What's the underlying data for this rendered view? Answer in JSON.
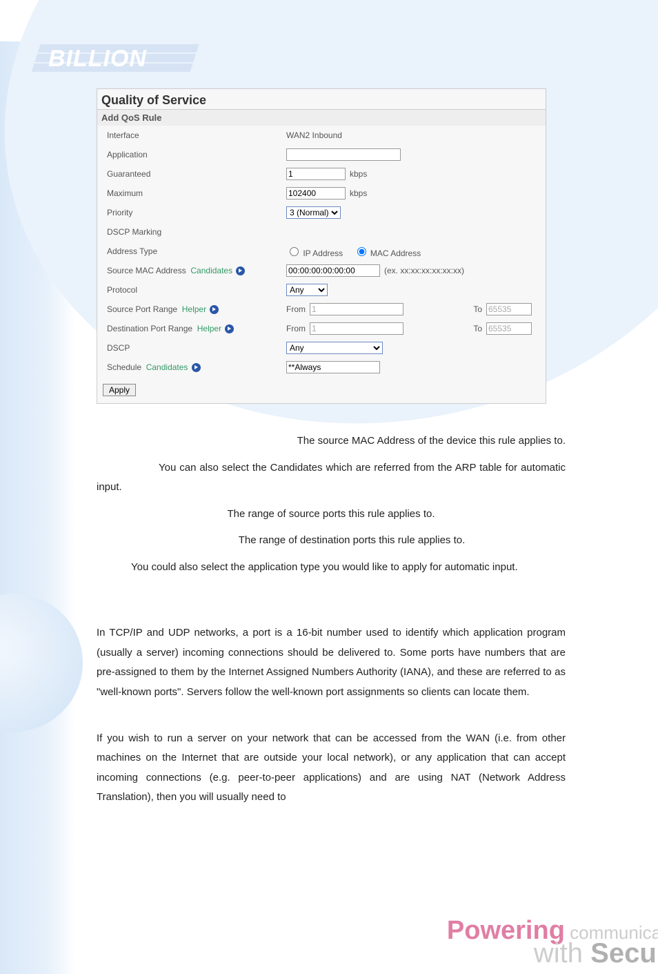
{
  "logo_text": "BILLION",
  "panel": {
    "title": "Quality of Service",
    "subtitle": "Add QoS Rule",
    "rows": {
      "interface": {
        "label": "Interface",
        "value": "WAN2 Inbound"
      },
      "application": {
        "label": "Application",
        "value": ""
      },
      "guaranteed": {
        "label": "Guaranteed",
        "value": "1",
        "unit": "kbps"
      },
      "maximum": {
        "label": "Maximum",
        "value": "102400",
        "unit": "kbps"
      },
      "priority": {
        "label": "Priority",
        "value": "3 (Normal)"
      },
      "dscp_marking": {
        "label": "DSCP Marking"
      },
      "address_type": {
        "label": "Address Type",
        "opt_ip": "IP Address",
        "opt_mac": "MAC Address",
        "selected": "mac"
      },
      "source_mac": {
        "label": "Source MAC Address",
        "link": "Candidates",
        "value": "00:00:00:00:00:00",
        "hint": "(ex. xx:xx:xx:xx:xx:xx)"
      },
      "protocol": {
        "label": "Protocol",
        "value": "Any"
      },
      "source_port": {
        "label": "Source Port Range",
        "link": "Helper",
        "from_label": "From",
        "from": "1",
        "to_label": "To",
        "to": "65535"
      },
      "dest_port": {
        "label": "Destination Port Range",
        "link": "Helper",
        "from_label": "From",
        "from": "1",
        "to_label": "To",
        "to": "65535"
      },
      "dscp": {
        "label": "DSCP",
        "value": "Any"
      },
      "schedule": {
        "label": "Schedule",
        "link": "Candidates",
        "value": "**Always"
      }
    },
    "apply": "Apply"
  },
  "doc": {
    "p1": "The source MAC Address of the device this rule applies to.",
    "p2": "You can also select the Candidates which are referred from the ARP table for automatic input.",
    "p3": "The range of source ports this rule applies to.",
    "p4": "The range of destination ports this rule applies to.",
    "p5": "You could also select the application type you would like to apply for automatic input.",
    "p6": "In TCP/IP and UDP networks, a port is a 16-bit number used to identify which application program (usually a server) incoming connections should be delivered to. Some ports have numbers that are pre-assigned to them by the Internet Assigned Numbers Authority (IANA), and these are referred to as \"well-known ports\". Servers follow the well-known port assignments so clients can locate them.",
    "p7": "If you wish to run a server on your network that can be accessed from the WAN (i.e. from other machines on the Internet that are outside your local network), or any application that can accept incoming connections (e.g. peer-to-peer applications) and are using NAT (Network Address Translation), then you will usually need to"
  },
  "footer": {
    "powering": "Powering",
    "communications": " communications",
    "with": "with ",
    "security": "Security"
  }
}
